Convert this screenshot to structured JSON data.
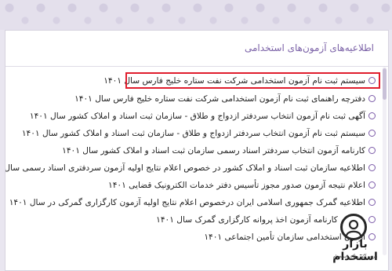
{
  "section_title": "اطلاعیه‌های آزمون‌های استخدامی",
  "items": [
    {
      "label": "سیستم ثبت نام آزمون استخدامی شرکت نفت ستاره خلیج فارس سال ۱۴۰۱"
    },
    {
      "label": "دفترچه راهنمای ثبت نام آزمون استخدامی شرکت نفت ستاره خلیج فارس سال ۱۴۰۱"
    },
    {
      "label": "آگهی ثبت نام آزمون انتخاب سردفتر ازدواج و طلاق - سازمان ثبت اسناد و املاک کشور سال ۱۴۰۱"
    },
    {
      "label": "سیستم ثبت نام آزمون انتخاب سردفتر ازدواج و طلاق - سازمان ثبت اسناد و املاک کشور سال ۱۴۰۱"
    },
    {
      "label": "کارنامه آزمون انتخاب سردفتر اسناد رسمی سازمان ثبت اسناد و املاک کشور سال ۱۴۰۱"
    },
    {
      "label": "اطلاعیه سازمان ثبت اسناد و املاک کشور در خصوص اعلام نتایج اولیه آزمون سردفتری اسناد رسمی سال ۱۴۰۱"
    },
    {
      "label": "اعلام نتیجه آزمون صدور مجوز تأسیس دفتر خدمات الکترونیک قضایی ۱۴۰۱"
    },
    {
      "label": "اطلاعیه گمرک جمهوری اسلامی ایران درخصوص اعلام نتایج اولیه آزمون کارگزاری گمرکی در سال ۱۴۰۱"
    },
    {
      "label": "سیستم کارنامه آزمون اخذ پروانه کارگزاری گمرک سال ۱۴۰۱"
    },
    {
      "label": "آزمون استخدامی سازمان تأمین اجتماعی ۱۴۰۱"
    }
  ],
  "watermark": {
    "text": "بازار استخدام",
    "subtext": "مرجع آگهی های استخدام"
  },
  "colors": {
    "accent": "#7b62a7",
    "highlight_border": "#e01d2d"
  }
}
